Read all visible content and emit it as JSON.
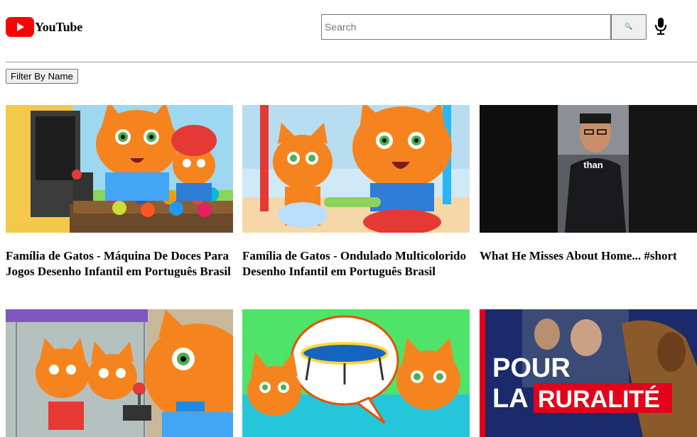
{
  "header": {
    "logo_text": "YouTube",
    "search": {
      "placeholder": "Search",
      "value": ""
    },
    "search_button_icon": "search-icon",
    "mic_icon": "microphone-icon"
  },
  "toolbar": {
    "filter_label": "Filter By Name"
  },
  "videos": [
    {
      "title": "Família de Gatos - Máquina De Doces Para Jogos Desenho Infantil em Português Brasil"
    },
    {
      "title": "Família de Gatos - Ondulado Multicolorido Desenho Infantil em Português Brasil"
    },
    {
      "title": "What He Misses About Home... #short",
      "overlay_text": "than"
    },
    {
      "title": ""
    },
    {
      "title": ""
    },
    {
      "title": "",
      "overlay_text_line1": "POUR",
      "overlay_text_line2_prefix": "LA",
      "overlay_text_line2_highlight": "RURALITÉ"
    }
  ],
  "colors": {
    "brand_red": "#ff0000",
    "cat_orange": "#f5841f",
    "highlight_red": "#e3001b",
    "navy": "#1b2a6b"
  }
}
